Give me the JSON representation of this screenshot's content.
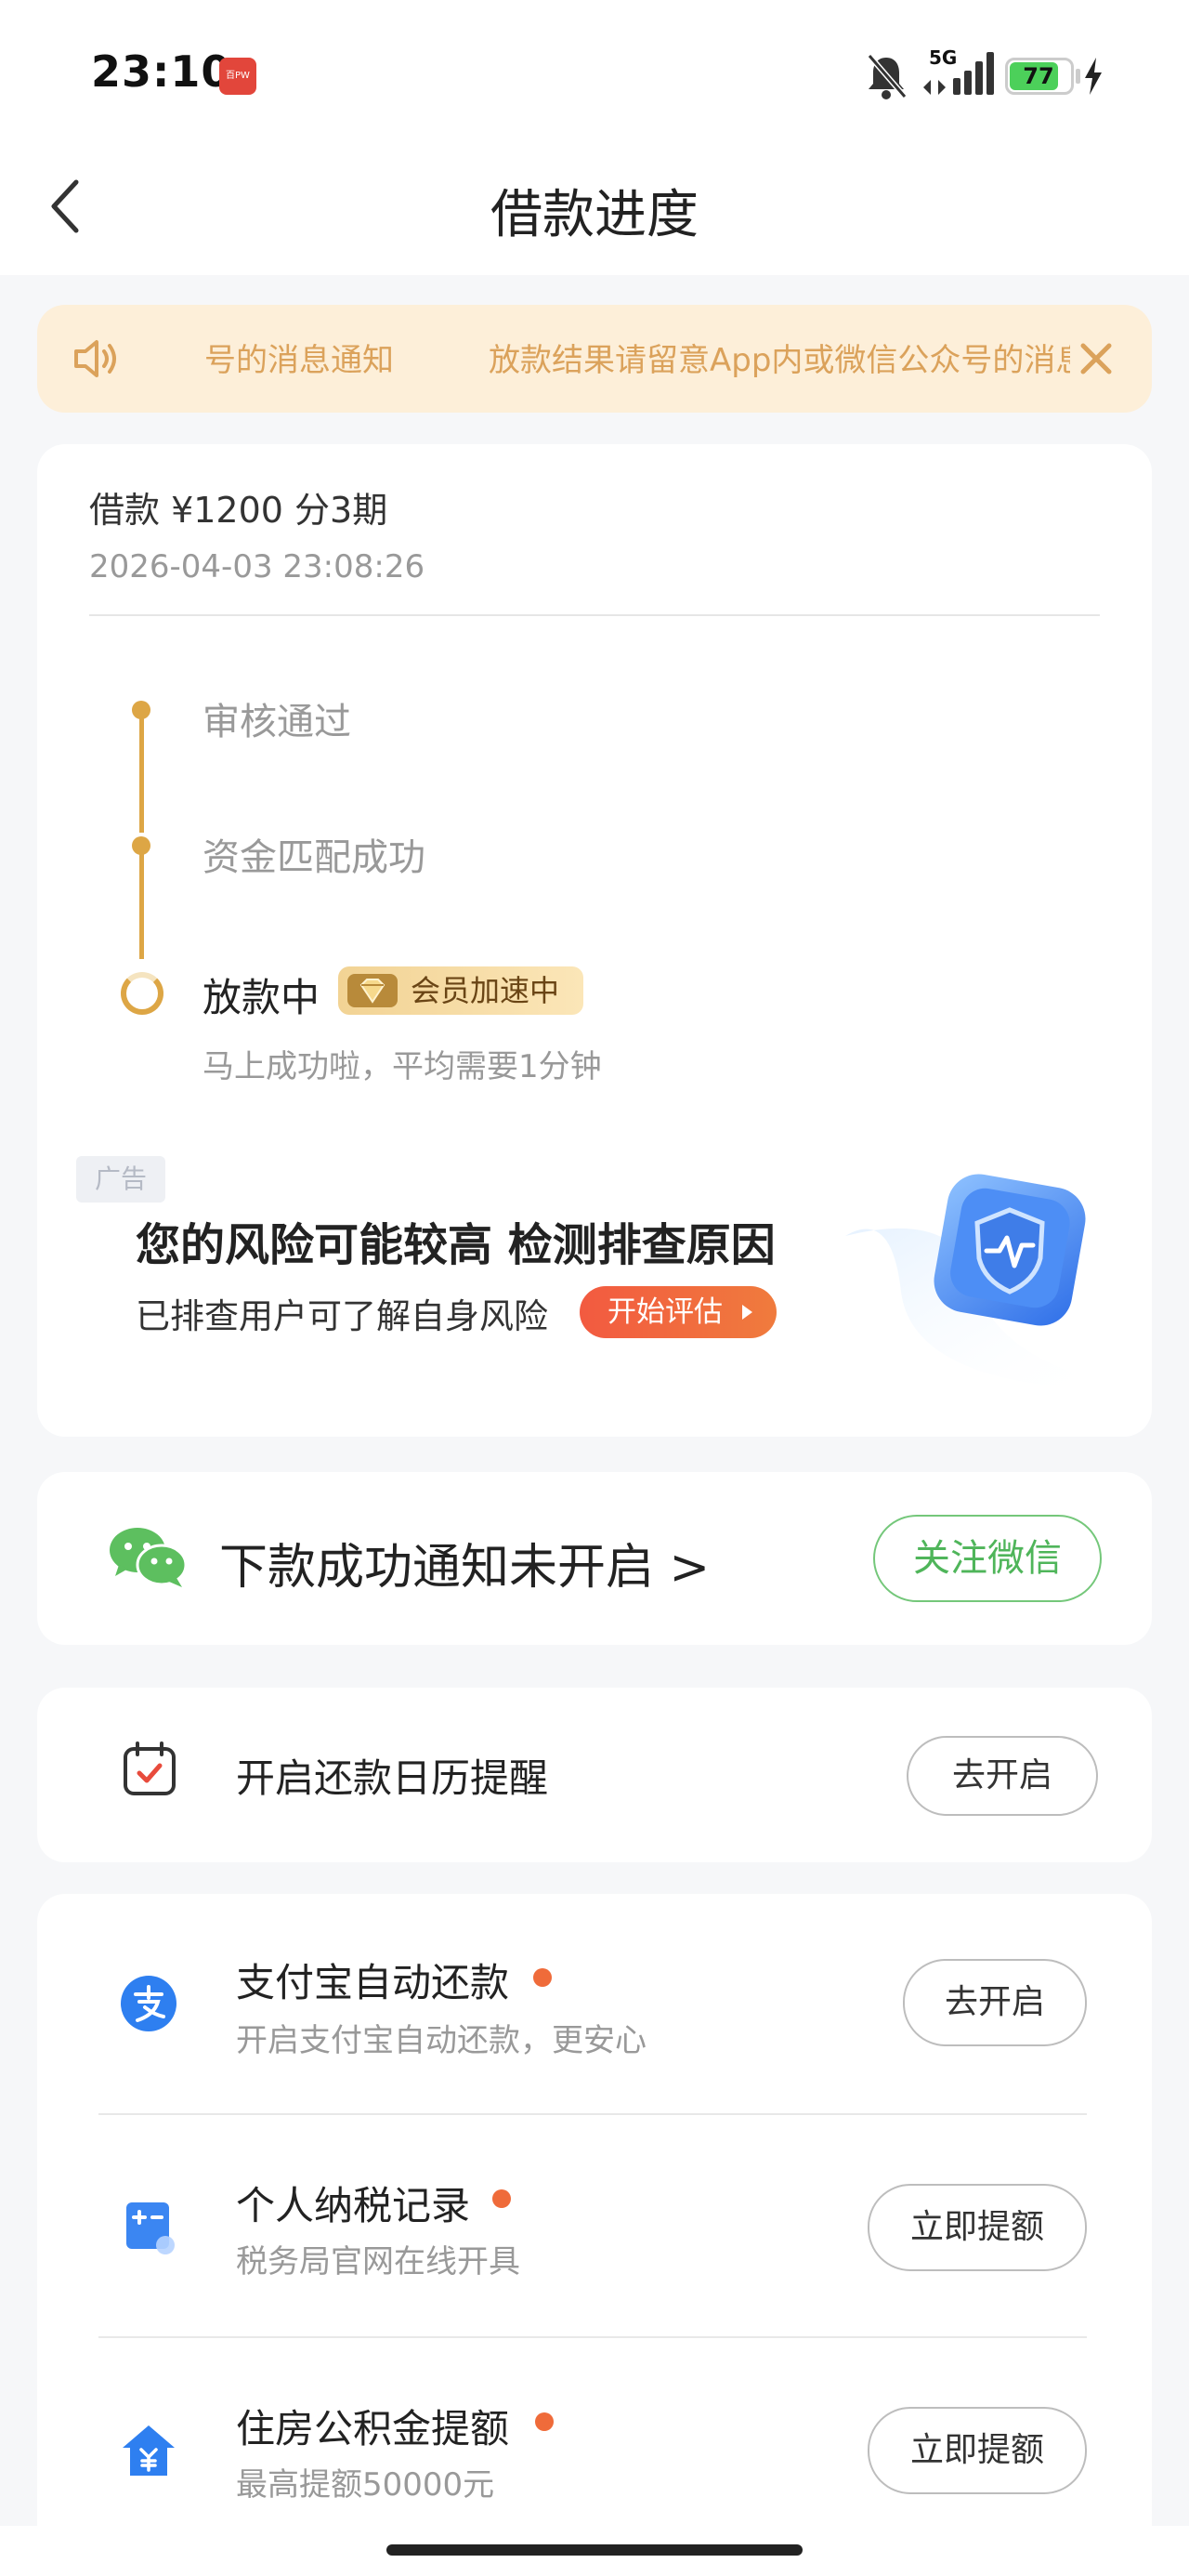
{
  "status_bar": {
    "time": "23:10",
    "app_badge": "百PW",
    "network": "5G",
    "battery": "77"
  },
  "header": {
    "title": "借款进度"
  },
  "notice": {
    "text": "　　号的消息通知　　　放款结果请留意App内或微信公众号的消息"
  },
  "loan": {
    "title": "借款 ¥1200  分3期",
    "datetime": "2026-04-03 23:08:26",
    "steps": [
      {
        "label": "审核通过"
      },
      {
        "label": "资金匹配成功"
      },
      {
        "label": "放款中",
        "badge": "会员加速中",
        "sub": "马上成功啦，平均需要1分钟"
      }
    ]
  },
  "ad": {
    "tag": "广告",
    "title": "您的风险可能较高 检测排查原因",
    "subtitle": "已排查用户可了解自身风险",
    "button": "开始评估"
  },
  "wechat": {
    "text": "下款成功通知未开启 >",
    "button": "关注微信"
  },
  "calendar": {
    "text": "开启还款日历提醒",
    "button": "去开启"
  },
  "list": [
    {
      "title": "支付宝自动还款",
      "sub": "开启支付宝自动还款，更安心",
      "button": "去开启"
    },
    {
      "title": "个人纳税记录",
      "sub": "税务局官网在线开具",
      "button": "立即提额"
    },
    {
      "title": "住房公积金提额",
      "sub": "最高提额50000元",
      "button": "立即提额"
    }
  ],
  "colors": {
    "gold": "#dda645",
    "notice_bg": "#fdefd9",
    "wechat_green": "#4fb55a",
    "alert_orange": "#ef6b3a"
  }
}
